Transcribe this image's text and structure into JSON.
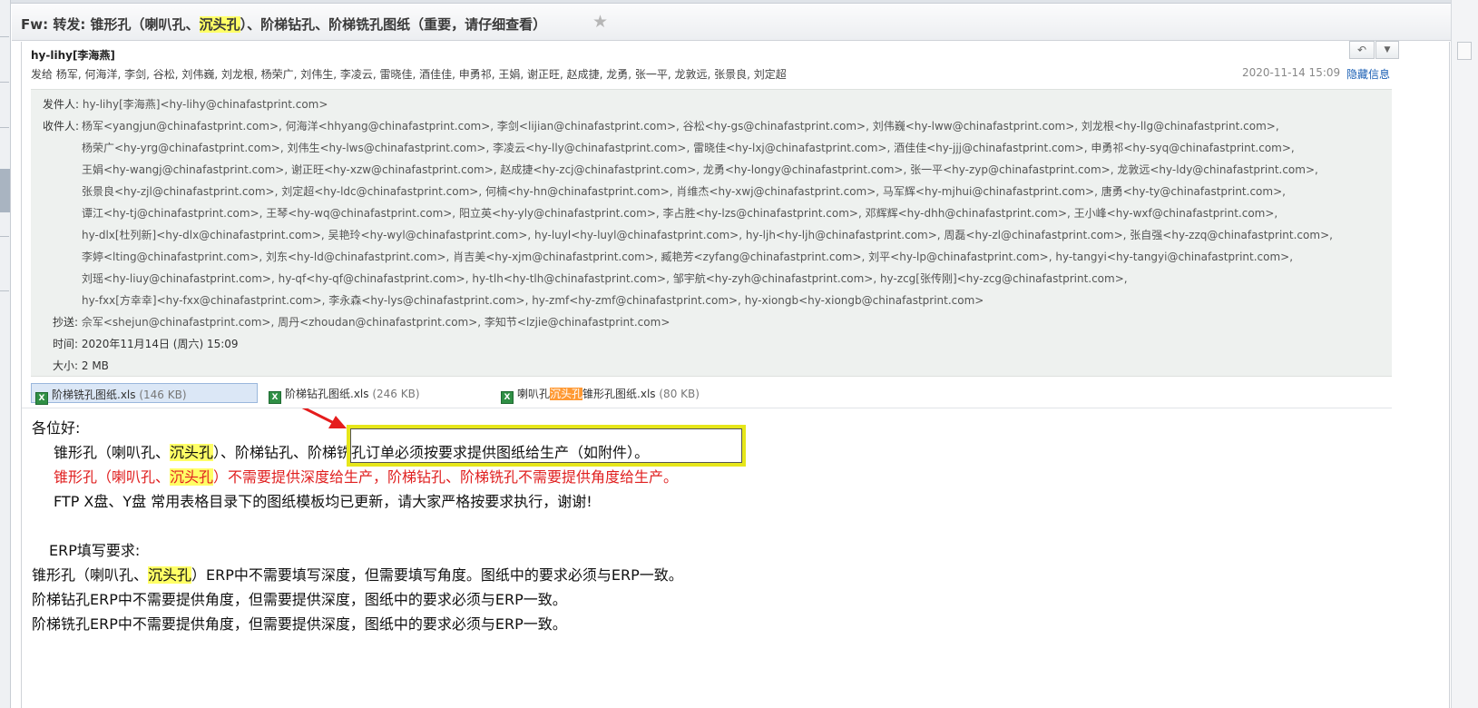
{
  "subject": {
    "prefix": "Fw: 转发: 锥形孔（喇叭孔、",
    "highlight": "沉头孔",
    "suffix": "）、阶梯钻孔、阶梯铣孔图纸（重要，请仔细查看）",
    "star_icon": "star-icon"
  },
  "sender": {
    "name": "hy-lihy[李海燕]",
    "recipients_line": "发给 杨军, 何海洋, 李剑, 谷松, 刘伟巍, 刘龙根, 杨荣广, 刘伟生, 李凌云, 雷晓佳, 酒佳佳, 申勇祁, 王娟, 谢正旺, 赵成捷, 龙勇, 张一平, 龙敦远, 张景良, 刘定超",
    "date": "2020-11-14 15:09",
    "hide_label": "隐藏信息",
    "reply_icon": "reply-icon",
    "more_icon": "chevron-down-icon"
  },
  "details": {
    "from_label": "发件人:",
    "from_value": "hy-lihy[李海燕]<hy-lihy@chinafastprint.com>",
    "to_label": "收件人:",
    "to_lines": [
      "杨军<yangjun@chinafastprint.com>,  何海洋<hhyang@chinafastprint.com>,  李剑<lijian@chinafastprint.com>,  谷松<hy-gs@chinafastprint.com>,  刘伟巍<hy-lww@chinafastprint.com>,  刘龙根<hy-llg@chinafastprint.com>,",
      "杨荣广<hy-yrg@chinafastprint.com>,  刘伟生<hy-lws@chinafastprint.com>,  李凌云<hy-lly@chinafastprint.com>,  雷晓佳<hy-lxj@chinafastprint.com>,  酒佳佳<hy-jjj@chinafastprint.com>,  申勇祁<hy-syq@chinafastprint.com>,",
      "王娟<hy-wangj@chinafastprint.com>,  谢正旺<hy-xzw@chinafastprint.com>,  赵成捷<hy-zcj@chinafastprint.com>,  龙勇<hy-longy@chinafastprint.com>,  张一平<hy-zyp@chinafastprint.com>,  龙敦远<hy-ldy@chinafastprint.com>,",
      "张景良<hy-zjl@chinafastprint.com>,  刘定超<hy-ldc@chinafastprint.com>,  何楠<hy-hn@chinafastprint.com>,  肖维杰<hy-xwj@chinafastprint.com>,  马军辉<hy-mjhui@chinafastprint.com>,  唐勇<hy-ty@chinafastprint.com>,",
      "谭江<hy-tj@chinafastprint.com>,  王琴<hy-wq@chinafastprint.com>,  阳立英<hy-yly@chinafastprint.com>,  李占胜<hy-lzs@chinafastprint.com>,  邓辉辉<hy-dhh@chinafastprint.com>,  王小峰<hy-wxf@chinafastprint.com>,",
      "hy-dlx[杜列新]<hy-dlx@chinafastprint.com>,  吴艳玲<hy-wyl@chinafastprint.com>,  hy-luyl<hy-luyl@chinafastprint.com>,  hy-ljh<hy-ljh@chinafastprint.com>,  周磊<hy-zl@chinafastprint.com>,  张自强<hy-zzq@chinafastprint.com>,",
      "李婷<lting@chinafastprint.com>,  刘东<hy-ld@chinafastprint.com>,  肖吉美<hy-xjm@chinafastprint.com>,  臧艳芳<zyfang@chinafastprint.com>,  刘平<hy-lp@chinafastprint.com>,  hy-tangyi<hy-tangyi@chinafastprint.com>,",
      "刘瑶<hy-liuy@chinafastprint.com>,  hy-qf<hy-qf@chinafastprint.com>,  hy-tlh<hy-tlh@chinafastprint.com>,  邹宇航<hy-zyh@chinafastprint.com>,  hy-zcg[张传刚]<hy-zcg@chinafastprint.com>,",
      "hy-fxx[方幸幸]<hy-fxx@chinafastprint.com>,  李永森<hy-lys@chinafastprint.com>,  hy-zmf<hy-zmf@chinafastprint.com>,  hy-xiongb<hy-xiongb@chinafastprint.com>"
    ],
    "cc_label": "抄送:",
    "cc_value": "佘军<shejun@chinafastprint.com>,  周丹<zhoudan@chinafastprint.com>,  李知节<lzjie@chinafastprint.com>",
    "time_label": "时间:",
    "time_value": "2020年11月14日 (周六) 15:09",
    "size_label": "大小:",
    "size_value": "2 MB"
  },
  "attachments": [
    {
      "name": "阶梯铣孔图纸.xls",
      "size": "(146 KB)",
      "icon": "excel-file-icon",
      "selected": true
    },
    {
      "name": "阶梯钻孔图纸.xls",
      "size": "(246 KB)",
      "icon": "excel-file-icon",
      "selected": false
    },
    {
      "name_prefix": "喇叭孔",
      "name_highlight": "沉头孔",
      "name_suffix": "锥形孔图纸.xls",
      "size": "(80 KB)",
      "icon": "excel-file-icon",
      "selected": false
    }
  ],
  "body": {
    "greeting": "各位好:",
    "line1_a": "锥形孔（喇叭孔、",
    "line1_hl": "沉头孔",
    "line1_b": "）、阶梯钻孔、",
    "line1_boxed": "阶梯铣孔订单必须按要求提供图纸给生产（如附件）",
    "line1_end": "。",
    "line2_a": "锥形孔（喇叭孔、",
    "line2_hl": "沉头孔",
    "line2_b": "）不需要提供深度给生产，阶梯钻孔、阶梯铣孔不需要提供角度给生产。",
    "line3": "FTP X盘、Y盘 常用表格目录下的图纸模板均已更新，请大家严格按要求执行，谢谢!",
    "erp_title": "ERP填写要求:",
    "erp1_a": "锥形孔（喇叭孔、",
    "erp1_hl": "沉头孔",
    "erp1_b": "）ERP中不需要填写深度，但需要填写角度。图纸中的要求必须与ERP一致。",
    "erp2": "阶梯钻孔ERP中不需要提供角度，但需要提供深度，图纸中的要求必须与ERP一致。",
    "erp3": "阶梯铣孔ERP中不需要提供角度，但需要提供深度，图纸中的要求必须与ERP一致。"
  },
  "colors": {
    "highlight_yellow": "#ffff66",
    "highlight_orange": "#ff9933",
    "red_text": "#e02020",
    "callout_yellow": "#e6e61a",
    "arrow_red": "#e51c1c",
    "link_blue": "#1a5fb4"
  }
}
